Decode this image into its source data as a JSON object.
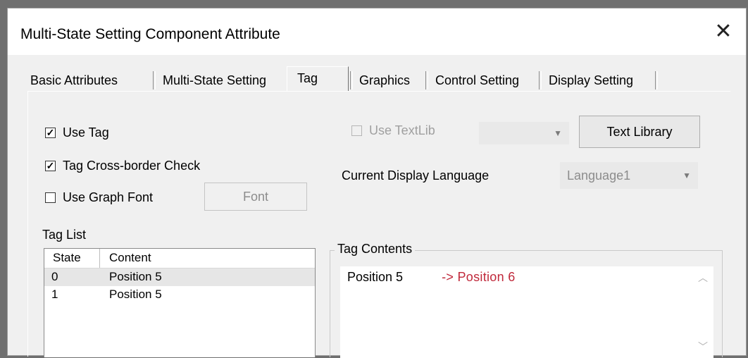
{
  "window": {
    "title": "Multi-State Setting Component Attribute",
    "close_glyph": "✕"
  },
  "tabs": [
    {
      "label": "Basic Attributes",
      "active": false
    },
    {
      "label": "Multi-State Setting",
      "active": false
    },
    {
      "label": "Tag",
      "active": true
    },
    {
      "label": "Graphics",
      "active": false
    },
    {
      "label": "Control Setting",
      "active": false
    },
    {
      "label": "Display Setting",
      "active": false
    }
  ],
  "options": {
    "use_tag": {
      "label": "Use Tag",
      "checked": true
    },
    "cross_border": {
      "label": "Tag Cross-border Check",
      "checked": true
    },
    "use_graph_font": {
      "label": "Use Graph Font",
      "checked": false
    },
    "font_button": "Font",
    "use_textlib": {
      "label": "Use TextLib",
      "checked": false,
      "disabled": true
    },
    "textlib_select_value": "",
    "text_library_button": "Text Library",
    "display_language_label": "Current Display Language",
    "display_language_value": "Language1"
  },
  "tag_list": {
    "label": "Tag List",
    "columns": [
      "State",
      "Content"
    ],
    "rows": [
      {
        "state": "0",
        "content": "Position 5",
        "selected": true
      },
      {
        "state": "1",
        "content": "Position 5",
        "selected": false
      }
    ]
  },
  "tag_contents": {
    "label": "Tag Contents",
    "text": "Position 5",
    "annotation": "-> Position 6"
  },
  "colors": {
    "annotation": "#c0283a",
    "dialog_bg": "#f0f0f0",
    "backdrop": "#6f6f6f"
  }
}
